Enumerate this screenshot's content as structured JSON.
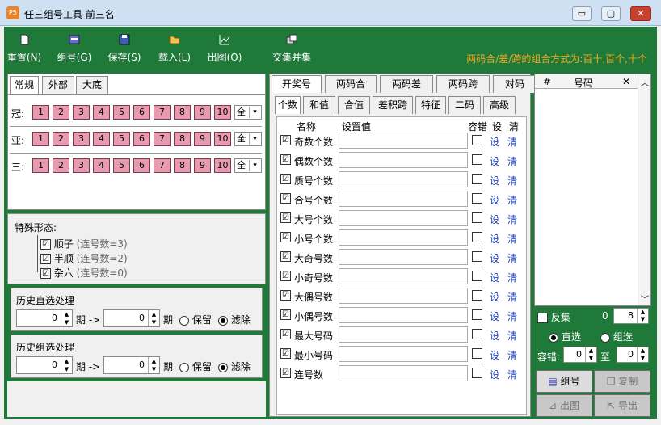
{
  "window": {
    "title": "任三组号工具 前三名",
    "app_icon_text": "P5",
    "min": "▭",
    "max": "▢",
    "close": "✕"
  },
  "toolbar": {
    "items": [
      {
        "label": "重置(N)",
        "icon": "new-document-icon"
      },
      {
        "label": "组号(G)",
        "icon": "generate-icon"
      },
      {
        "label": "保存(S)",
        "icon": "save-icon"
      },
      {
        "label": "载入(L)",
        "icon": "open-folder-icon"
      },
      {
        "label": "出图(O)",
        "icon": "chart-icon"
      },
      {
        "label": "交集并集",
        "icon": "set-icon"
      }
    ],
    "note": "两码合/差/跨的组合方式为:百十,百个,十个"
  },
  "left": {
    "tabs": [
      "常规",
      "外部",
      "大底"
    ],
    "positions": [
      {
        "label": "冠:",
        "select": "全"
      },
      {
        "label": "亚:",
        "select": "全"
      },
      {
        "label": "三:",
        "select": "全"
      }
    ],
    "numbers": [
      "1",
      "2",
      "3",
      "4",
      "5",
      "6",
      "7",
      "8",
      "9",
      "10"
    ],
    "special": {
      "title": "特殊形态:",
      "items": [
        {
          "label": "顺子",
          "hint": "(连号数=3)",
          "checked": "☑"
        },
        {
          "label": "半顺",
          "hint": "(连号数=2)",
          "checked": "☑"
        },
        {
          "label": "杂六",
          "hint": "(连号数=0)",
          "checked": "☑"
        }
      ]
    },
    "history_direct": {
      "title": "历史直选处理",
      "from": "0",
      "to": "0",
      "period": "期 ->",
      "period2": "期",
      "keep": "保留",
      "filter": "滤除"
    },
    "history_group": {
      "title": "历史组选处理",
      "from": "0",
      "to": "0",
      "period": "期 ->",
      "period2": "期",
      "keep": "保留",
      "filter": "滤除"
    }
  },
  "middle": {
    "tabs_top": [
      "开奖号",
      "两码合",
      "两码差",
      "两码跨",
      "对码"
    ],
    "tabs_sub": [
      "个数",
      "和值",
      "合值",
      "差积跨",
      "特征",
      "二码",
      "高级"
    ],
    "headers": {
      "name": "名称",
      "value": "设置值",
      "tolerance": "容错",
      "set": "设",
      "clear": "清"
    },
    "rows": [
      {
        "name": "奇数个数"
      },
      {
        "name": "偶数个数"
      },
      {
        "name": "质号个数"
      },
      {
        "name": "合号个数"
      },
      {
        "name": "大号个数"
      },
      {
        "name": "小号个数"
      },
      {
        "name": "大奇号数"
      },
      {
        "name": "小奇号数"
      },
      {
        "name": "大偶号数"
      },
      {
        "name": "小偶号数"
      },
      {
        "name": "最大号码"
      },
      {
        "name": "最小号码"
      },
      {
        "name": "连号数"
      }
    ],
    "set_label": "设",
    "clear_label": "清",
    "check": "☑"
  },
  "right": {
    "list_headers": {
      "index": "#",
      "number": "号码",
      "close": "✕"
    },
    "invert": {
      "label": "反集",
      "count": "0",
      "spin": "8"
    },
    "mode": {
      "direct": "直选",
      "group": "组选"
    },
    "tolerance": {
      "label": "容错:",
      "from": "0",
      "to_label": "至",
      "to": "0"
    },
    "buttons": {
      "generate": "组号",
      "copy": "复制",
      "chart": "出图",
      "export": "导出"
    }
  }
}
